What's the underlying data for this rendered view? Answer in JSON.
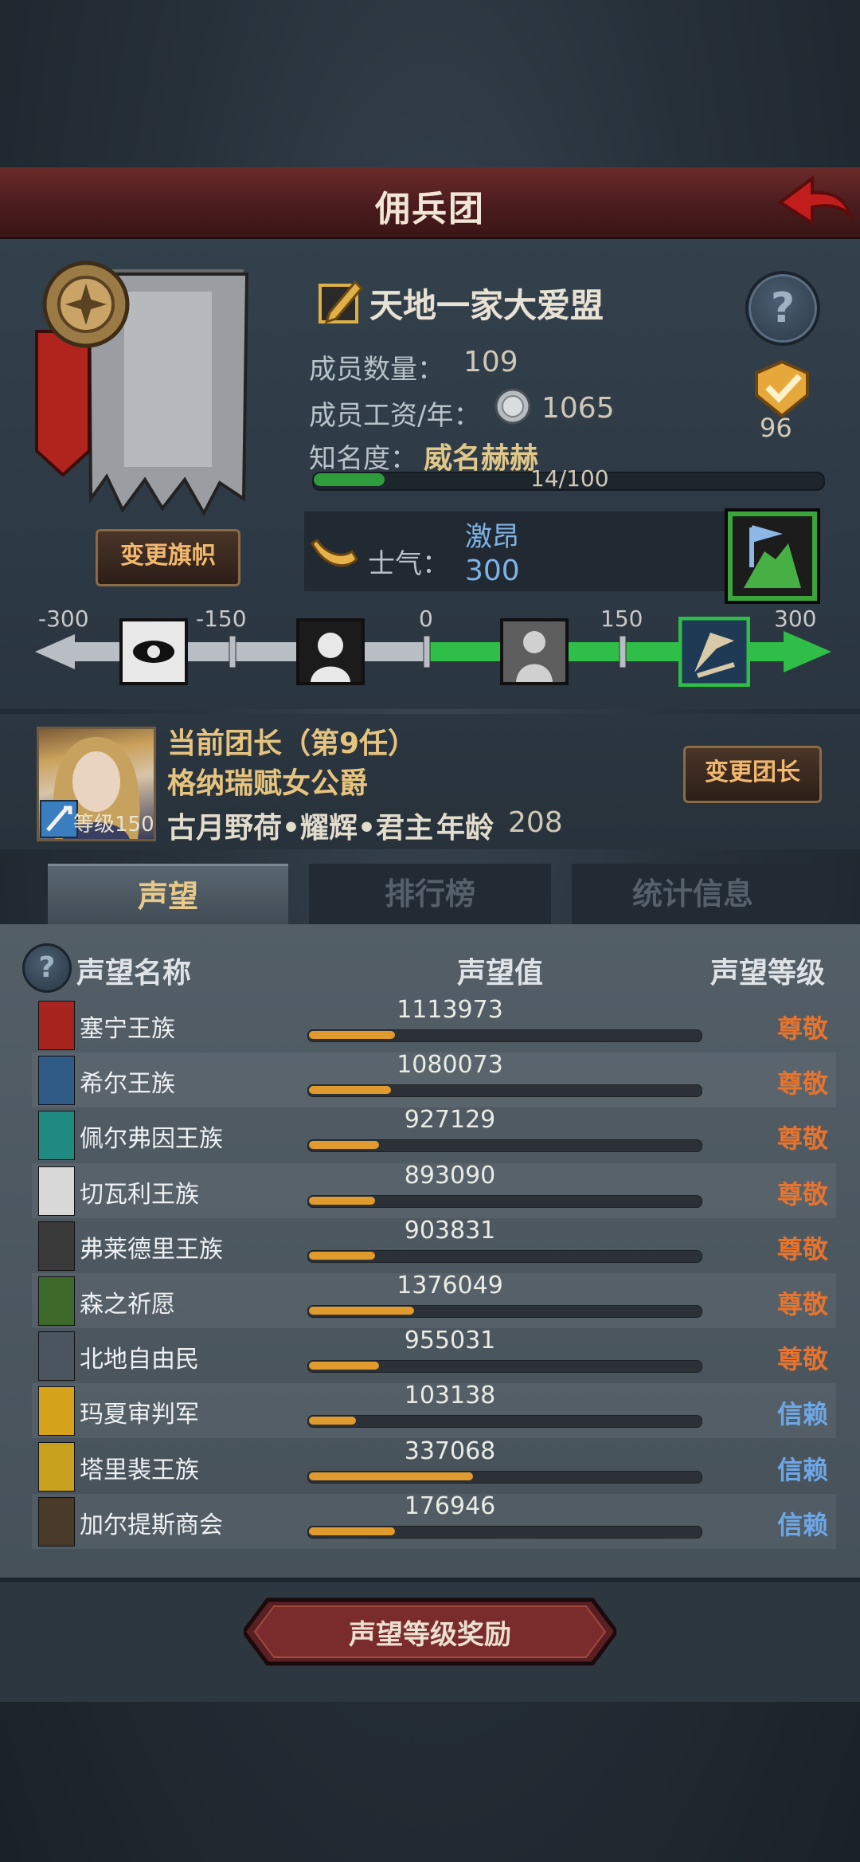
{
  "header": {
    "title": "佣兵团"
  },
  "guild": {
    "change_flag_label": "变更旗帜",
    "name": "天地一家大爱盟",
    "members_label": "成员数量：",
    "members": "109",
    "salary_label": "成员工资/年：",
    "salary": "1065",
    "fame_label": "知名度：",
    "fame_title": "威名赫赫",
    "fame_progress": "14/100",
    "fame_fraction": 0.14,
    "badge_value": "96",
    "morale_label": "士气：",
    "morale_word": "激昂",
    "morale_value": "300"
  },
  "morale_scale": {
    "ticks": [
      "-300",
      "-150",
      "0",
      "150",
      "300"
    ],
    "current": 300
  },
  "leader": {
    "title": "当前团长（第9任）",
    "noble_title": "格纳瑞赋女公爵",
    "level_label": "等级150",
    "name": "古月野荷•耀辉•君主",
    "age_label": "年龄",
    "age": "208",
    "change_label": "变更团长"
  },
  "tabs": [
    {
      "label": "声望",
      "active": true
    },
    {
      "label": "排行榜",
      "active": false
    },
    {
      "label": "统计信息",
      "active": false
    }
  ],
  "table": {
    "col_name": "声望名称",
    "col_value": "声望值",
    "col_level": "声望等级",
    "rows": [
      {
        "name": "塞宁王族",
        "value": "1113973",
        "fill": 0.22,
        "level": "尊敬",
        "color": "#a8241f"
      },
      {
        "name": "希尔王族",
        "value": "1080073",
        "fill": 0.21,
        "level": "尊敬",
        "color": "#2f5b86"
      },
      {
        "name": "佩尔弗因王族",
        "value": "927129",
        "fill": 0.18,
        "level": "尊敬",
        "color": "#1e8a80"
      },
      {
        "name": "切瓦利王族",
        "value": "893090",
        "fill": 0.17,
        "level": "尊敬",
        "color": "#d8d8d8"
      },
      {
        "name": "弗莱德里王族",
        "value": "903831",
        "fill": 0.17,
        "level": "尊敬",
        "color": "#3a3a3a"
      },
      {
        "name": "森之祈愿",
        "value": "1376049",
        "fill": 0.27,
        "level": "尊敬",
        "color": "#3d6a2a"
      },
      {
        "name": "北地自由民",
        "value": "955031",
        "fill": 0.18,
        "level": "尊敬",
        "color": "#4a5560"
      },
      {
        "name": "玛夏审判军",
        "value": "103138",
        "fill": 0.12,
        "level": "信赖",
        "color": "#d6a41a"
      },
      {
        "name": "塔里裴王族",
        "value": "337068",
        "fill": 0.42,
        "level": "信赖",
        "color": "#c8a21e"
      },
      {
        "name": "加尔提斯商会",
        "value": "176946",
        "fill": 0.22,
        "level": "信赖",
        "color": "#4a3a2a"
      }
    ]
  },
  "footer": {
    "reward_label": "声望等级奖励"
  },
  "colors": {
    "level_respect": "#e6742e",
    "level_trust": "#6ea7e6",
    "accent": "#e09a2d"
  }
}
